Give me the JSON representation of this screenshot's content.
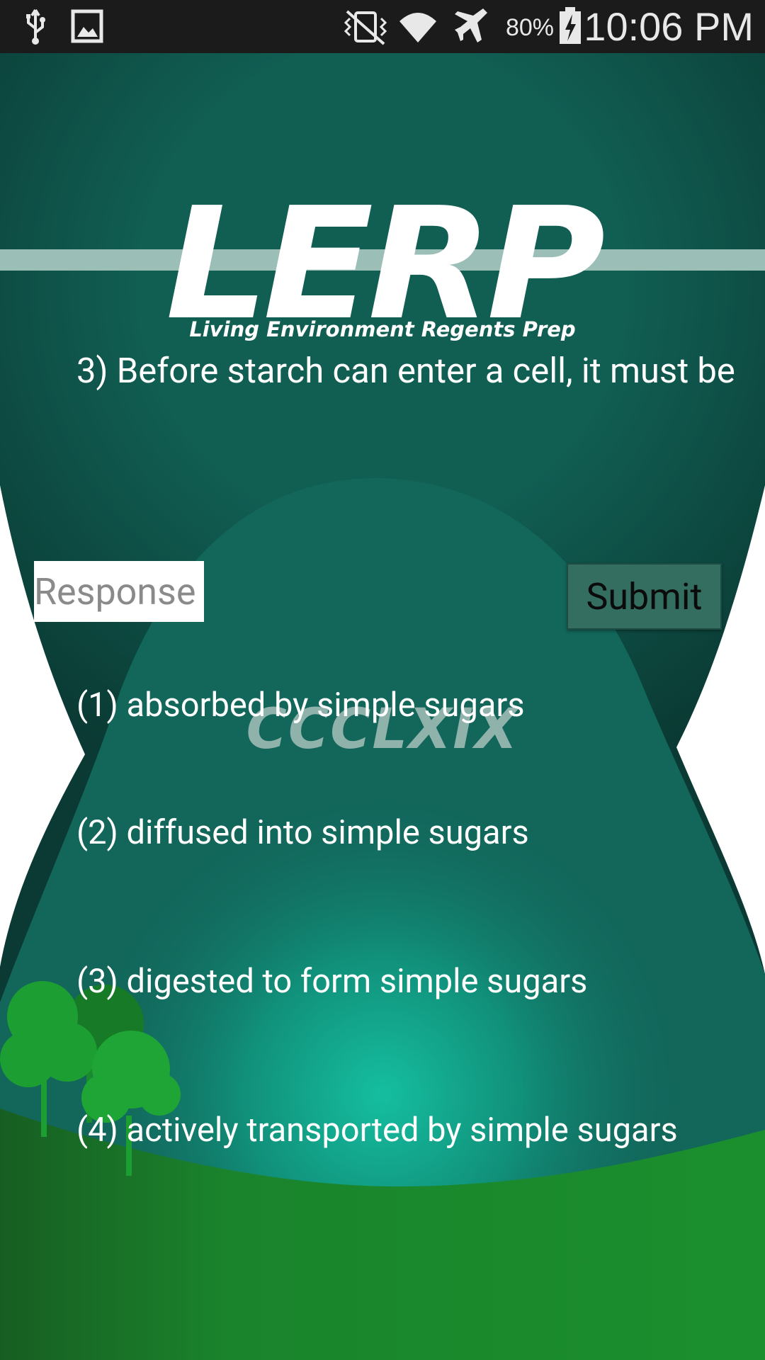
{
  "status_bar": {
    "left_icons": [
      "usb-icon",
      "image-icon"
    ],
    "right_icons": [
      "vibrate-icon",
      "wifi-icon",
      "airplane-icon",
      "battery-charging-icon"
    ],
    "battery": "80%",
    "time": "10:06 PM"
  },
  "logo": {
    "title": "LERP",
    "tagline": "Living Environment Regents Prep"
  },
  "watermark": "CCCLXIX",
  "question": "3) Before starch can enter a cell, it must be",
  "response": {
    "value": "",
    "placeholder": "Response"
  },
  "submit_label": "Submit",
  "choices": [
    "(1) absorbed by simple sugars",
    "(2) diffused into simple sugars",
    "(3) digested to form simple sugars",
    "(4) actively transported by simple sugars"
  ],
  "colors": {
    "teal_dark": "#0e4f44",
    "teal": "#12665a",
    "glow": "#14b89c",
    "grass": "#1a8a2c",
    "status_bar": "#1b1b1b"
  }
}
